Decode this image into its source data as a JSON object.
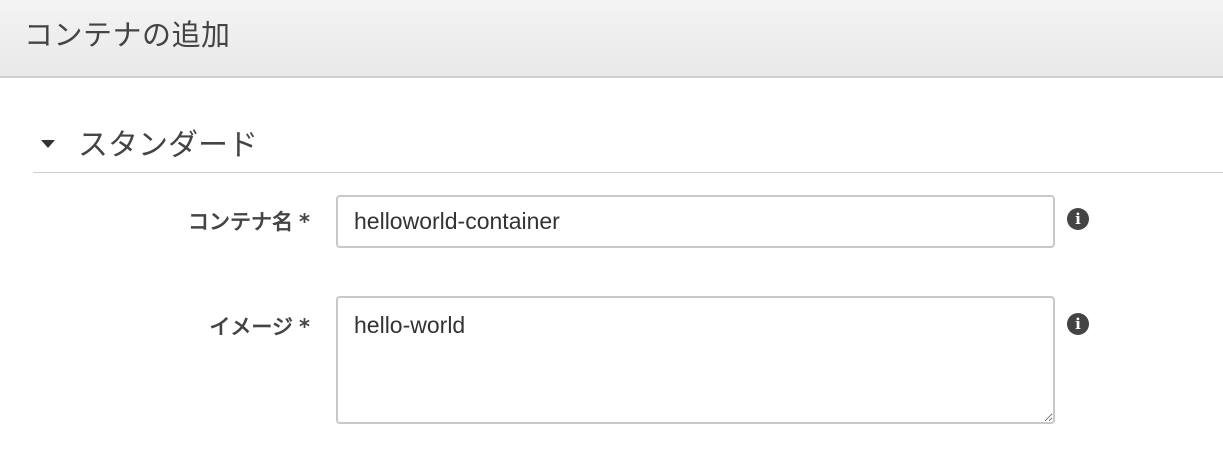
{
  "header": {
    "title": "コンテナの追加"
  },
  "section": {
    "title": "スタンダード",
    "expanded": true
  },
  "fields": {
    "container_name": {
      "label": "コンテナ名",
      "required_mark": "*",
      "value": "helloworld-container"
    },
    "image": {
      "label": "イメージ",
      "required_mark": "*",
      "value": "hello-world"
    }
  },
  "icons": {
    "info": "info-icon",
    "caret": "caret-down-icon"
  },
  "colors": {
    "header_bg": "#eeeeee",
    "text": "#444444",
    "input_border": "#c8c8c8"
  }
}
